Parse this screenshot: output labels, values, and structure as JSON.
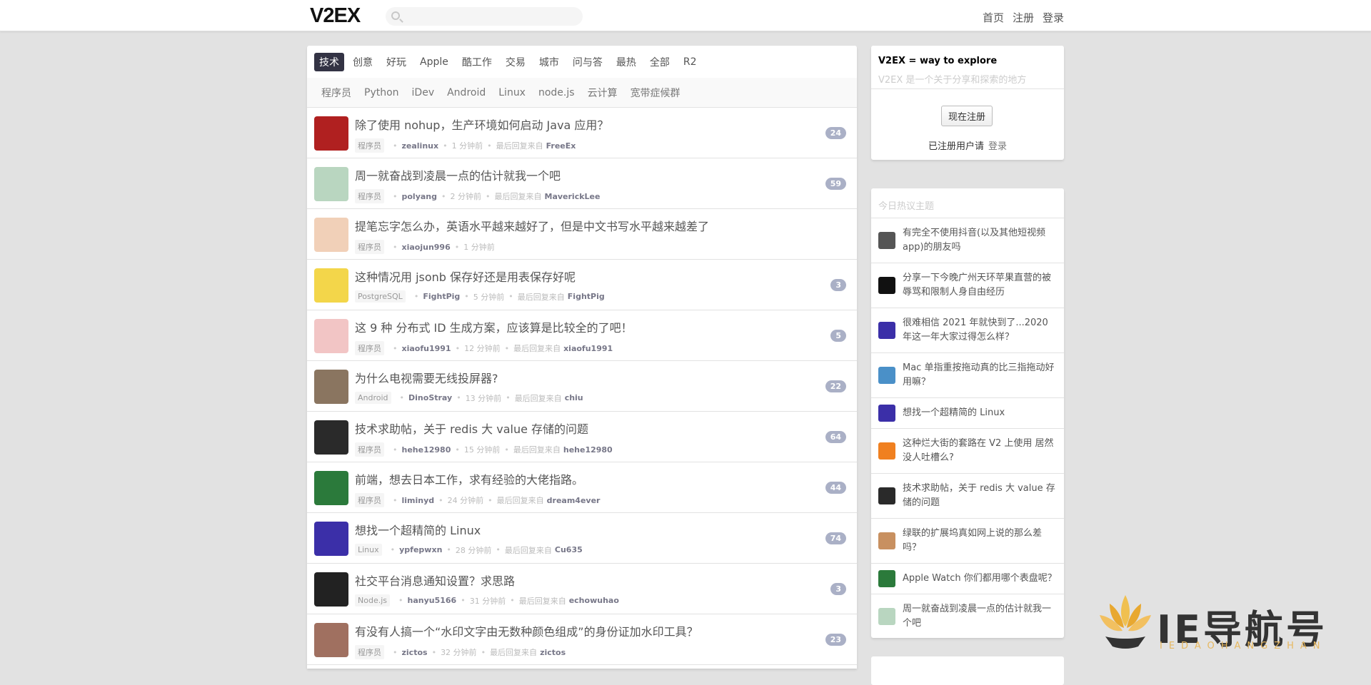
{
  "header": {
    "logo": "V2EX",
    "nav": [
      "首页",
      "注册",
      "登录"
    ]
  },
  "tabs": [
    "技术",
    "创意",
    "好玩",
    "Apple",
    "酷工作",
    "交易",
    "城市",
    "问与答",
    "最热",
    "全部",
    "R2"
  ],
  "subtabs": [
    "程序员",
    "Python",
    "iDev",
    "Android",
    "Linux",
    "node.js",
    "云计算",
    "宽带症候群"
  ],
  "topics": [
    {
      "title": "除了使用 nohup，生产环境如何启动 Java 应用？",
      "node": "程序员",
      "author": "zealinux",
      "time": "1 分钟前",
      "last_label": "最后回复来自",
      "last_reply": "FreeEx",
      "count": "24",
      "color": "#b02020"
    },
    {
      "title": "周一就奋战到凌晨一点的估计就我一个吧",
      "node": "程序员",
      "author": "polyang",
      "time": "2 分钟前",
      "last_label": "最后回复来自",
      "last_reply": "MaverickLee",
      "count": "59",
      "color": "#b9d6c0"
    },
    {
      "title": "提笔忘字怎么办，英语水平越来越好了，但是中文书写水平越来越差了",
      "node": "程序员",
      "author": "xiaojun996",
      "time": "1 分钟前",
      "last_label": "",
      "last_reply": "",
      "count": "",
      "color": "#f1d0b8"
    },
    {
      "title": "这种情况用 jsonb 保存好还是用表保存好呢",
      "node": "PostgreSQL",
      "author": "FightPig",
      "time": "5 分钟前",
      "last_label": "最后回复来自",
      "last_reply": "FightPig",
      "count": "3",
      "color": "#f3d64a"
    },
    {
      "title": "这 9 种 分布式 ID 生成方案，应该算是比较全的了吧！",
      "node": "程序员",
      "author": "xiaofu1991",
      "time": "12 分钟前",
      "last_label": "最后回复来自",
      "last_reply": "xiaofu1991",
      "count": "5",
      "color": "#f2c5c5"
    },
    {
      "title": "为什么电视需要无线投屏器?",
      "node": "Android",
      "author": "DinoStray",
      "time": "13 分钟前",
      "last_label": "最后回复来自",
      "last_reply": "chiu",
      "count": "22",
      "color": "#8a7560"
    },
    {
      "title": "技术求助帖，关于 redis 大 value 存储的问题",
      "node": "程序员",
      "author": "hehe12980",
      "time": "15 分钟前",
      "last_label": "最后回复来自",
      "last_reply": "hehe12980",
      "count": "64",
      "color": "#2a2a2a"
    },
    {
      "title": "前端，想去日本工作，求有经验的大佬指路。",
      "node": "程序员",
      "author": "liminyd",
      "time": "24 分钟前",
      "last_label": "最后回复来自",
      "last_reply": "dream4ever",
      "count": "44",
      "color": "#2b7a3b"
    },
    {
      "title": "想找一个超精简的 Linux",
      "node": "Linux",
      "author": "ypfepwxn",
      "time": "28 分钟前",
      "last_label": "最后回复来自",
      "last_reply": "Cu635",
      "count": "74",
      "color": "#3b2fa8"
    },
    {
      "title": "社交平台消息通知设置？求思路",
      "node": "Node.js",
      "author": "hanyu5166",
      "time": "31 分钟前",
      "last_label": "最后回复来自",
      "last_reply": "echowuhao",
      "count": "3",
      "color": "#222222"
    },
    {
      "title": "有没有人搞一个“水印文字由无数种颜色组成”的身份证加水印工具？",
      "node": "程序员",
      "author": "zictos",
      "time": "32 分钟前",
      "last_label": "最后回复来自",
      "last_reply": "zictos",
      "count": "23",
      "color": "#a07060"
    }
  ],
  "welcome": {
    "title": "V2EX = way to explore",
    "slogan": "V2EX 是一个关于分享和探索的地方",
    "signup": "现在注册",
    "registered": "已注册用户请",
    "login": "登录"
  },
  "hot": {
    "title": "今日热议主题",
    "items": [
      {
        "text": "有完全不使用抖音(以及其他短视频app)的朋友吗",
        "color": "#555555"
      },
      {
        "text": "分享一下今晚广州天环苹果直营的被辱骂和限制人身自由经历",
        "color": "#111111"
      },
      {
        "text": "很难相信 2021 年就快到了...2020 年这一年大家过得怎么样？",
        "color": "#3b2fa8"
      },
      {
        "text": "Mac 单指重按拖动真的比三指拖动好用嘛？",
        "color": "#4a90c8"
      },
      {
        "text": "想找一个超精简的 Linux",
        "color": "#3b2fa8"
      },
      {
        "text": "这种烂大街的套路在 V2 上使用 居然没人吐槽么?",
        "color": "#f08020"
      },
      {
        "text": "技术求助帖，关于 redis 大 value 存储的问题",
        "color": "#2a2a2a"
      },
      {
        "text": "绿联的扩展坞真如网上说的那么差吗？",
        "color": "#c89060"
      },
      {
        "text": "Apple Watch 你们都用哪个表盘呢？",
        "color": "#2b7a3b"
      },
      {
        "text": "周一就奋战到凌晨一点的估计就我一个吧",
        "color": "#b9d6c0"
      }
    ]
  },
  "watermark": {
    "text": "IE导航号",
    "sub": "IEDAOHANGZHAN"
  }
}
